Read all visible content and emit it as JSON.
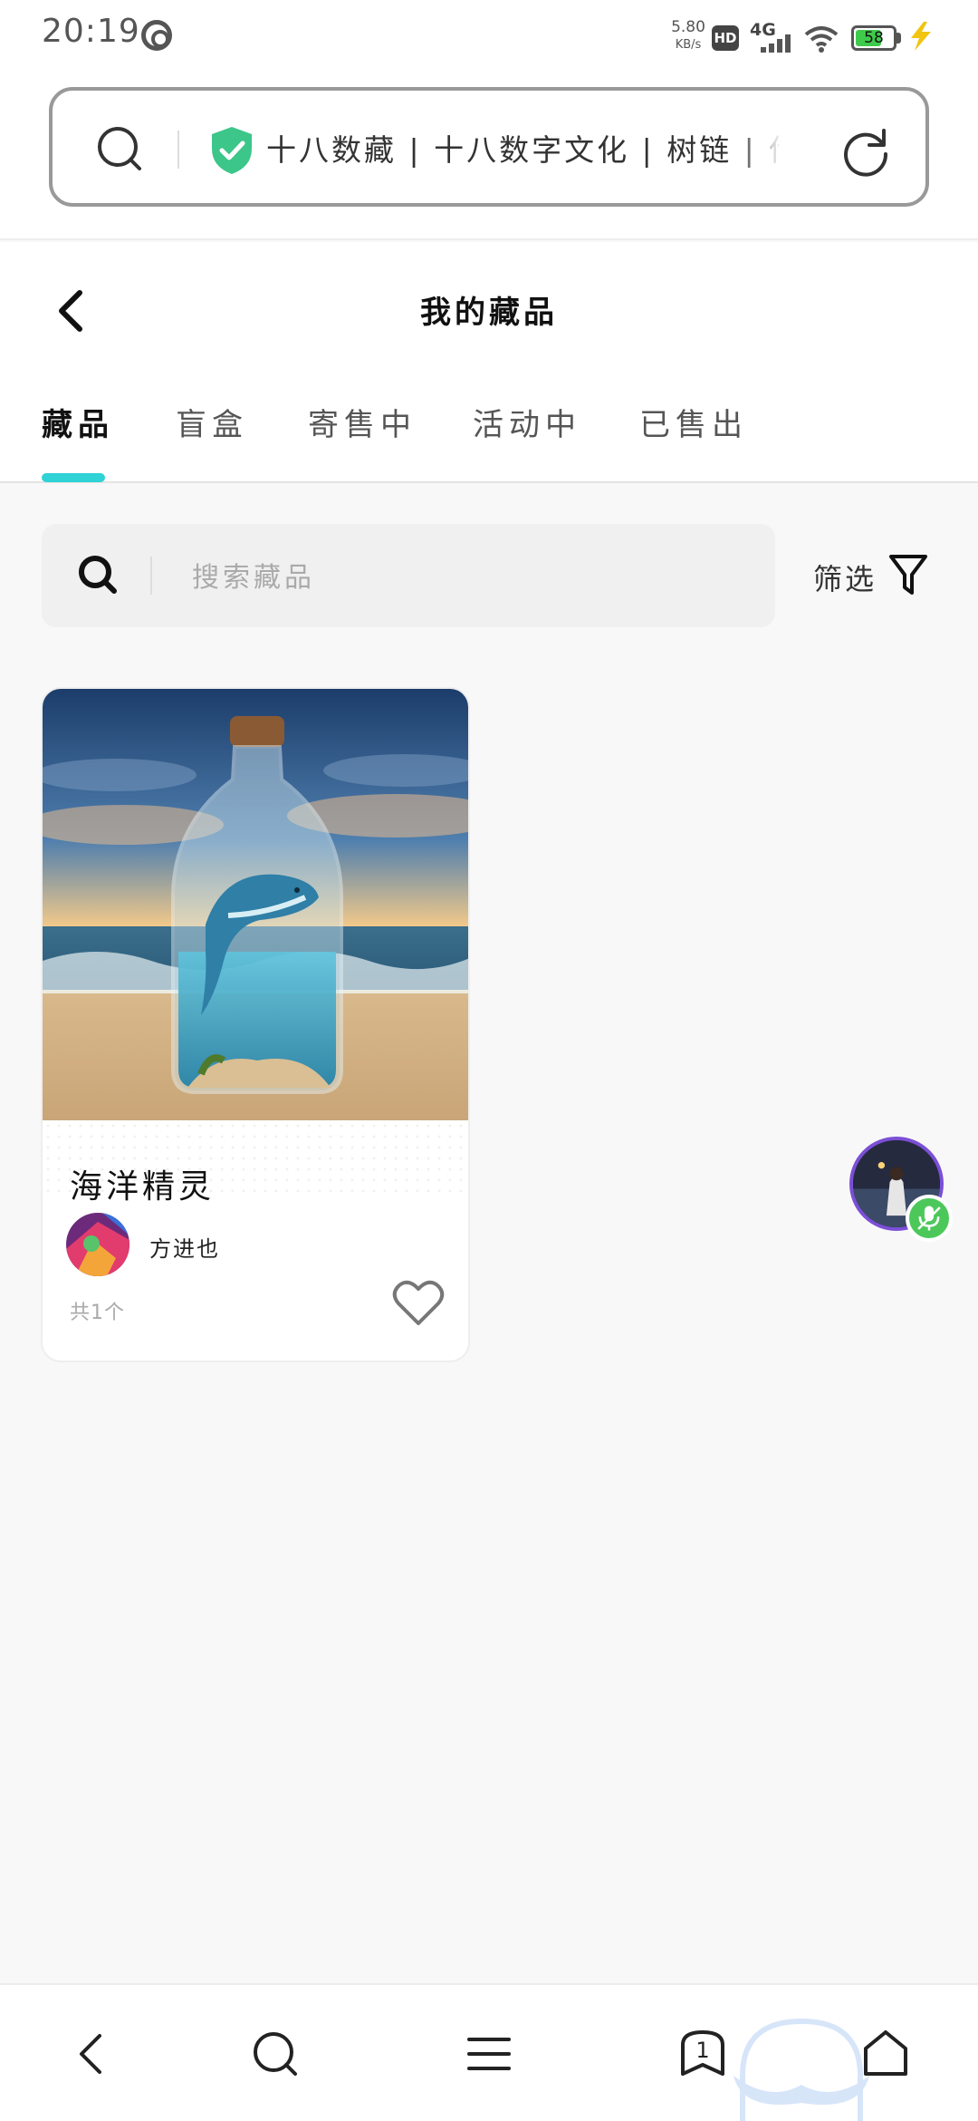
{
  "status_bar": {
    "time": "20:19",
    "net_speed_value": "5.80",
    "net_speed_unit": "KB/s",
    "hd_badge": "HD",
    "network_type": "4G",
    "battery_level": "58"
  },
  "browser": {
    "address_text": "十八数藏 | 十八数字文化 | 树链 | 传统",
    "icons": [
      "search-icon",
      "shield-check-icon",
      "reload-icon"
    ]
  },
  "page": {
    "title": "我的藏品",
    "tabs": [
      {
        "label": "藏品",
        "active": true
      },
      {
        "label": "盲盒",
        "active": false
      },
      {
        "label": "寄售中",
        "active": false
      },
      {
        "label": "活动中",
        "active": false
      },
      {
        "label": "已售出",
        "active": false
      }
    ],
    "search_placeholder": "搜索藏品",
    "filter_label": "筛选"
  },
  "items": [
    {
      "name": "海洋精灵",
      "creator": "方进也",
      "count": "共1个",
      "liked": false
    }
  ],
  "bottom_nav": {
    "items": [
      "back-icon",
      "search-icon",
      "menu-icon",
      "tabs-icon",
      "home-icon"
    ],
    "tab_count": "1"
  },
  "colors": {
    "accent": "#2fd3d6",
    "shield": "#3cc68a",
    "voice_ring": "#7b4fd6",
    "mic_badge": "#4cc85a"
  }
}
